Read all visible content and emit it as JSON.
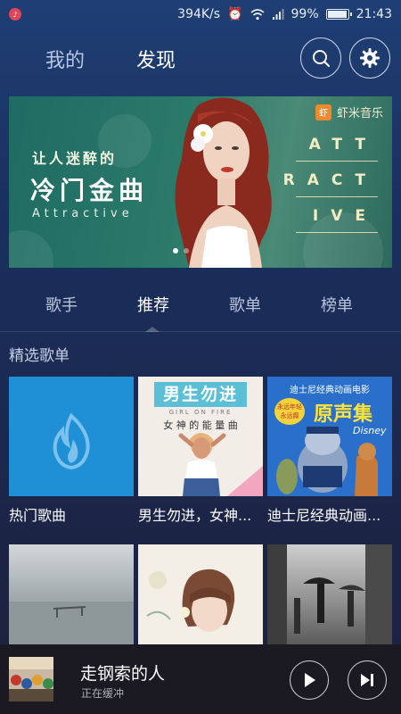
{
  "status_bar": {
    "network_speed": "394K/s",
    "battery": "99%",
    "time": "21:43"
  },
  "header": {
    "tabs": [
      {
        "label": "我的"
      },
      {
        "label": "发现"
      }
    ],
    "active_tab": "发现"
  },
  "banner": {
    "subtitle": "让人迷醉的",
    "title": "冷门金曲",
    "english": "Attractive",
    "brand": "虾米音乐",
    "brand_logo_char": "虾",
    "attr_lines": [
      "ATT",
      "RACT",
      "IVE"
    ]
  },
  "categories": {
    "tabs": [
      {
        "label": "歌手"
      },
      {
        "label": "推荐"
      },
      {
        "label": "歌单"
      },
      {
        "label": "榜单"
      }
    ],
    "active": "推荐"
  },
  "section": {
    "title": "精选歌单"
  },
  "playlists": [
    {
      "label": "热门歌曲"
    },
    {
      "label": "男生勿进，女神..."
    },
    {
      "label": "迪士尼经典动画..."
    }
  ],
  "covers": {
    "male_title": "男生勿进",
    "male_sub": "女 神 的 能 量 曲",
    "male_tiny": "GIRL ON FIRE",
    "disney_top": "迪士尼经典动画电影",
    "disney_badge": "永远年轻 永远癫",
    "disney_main": "原声集",
    "disney_logo": "Disney"
  },
  "player": {
    "title": "走钢索的人",
    "status": "正在缓冲"
  },
  "colors": {
    "accent_blue": "#1f90d6",
    "banner_green": "#2a7a6a",
    "player_bg": "#1b1a22"
  }
}
